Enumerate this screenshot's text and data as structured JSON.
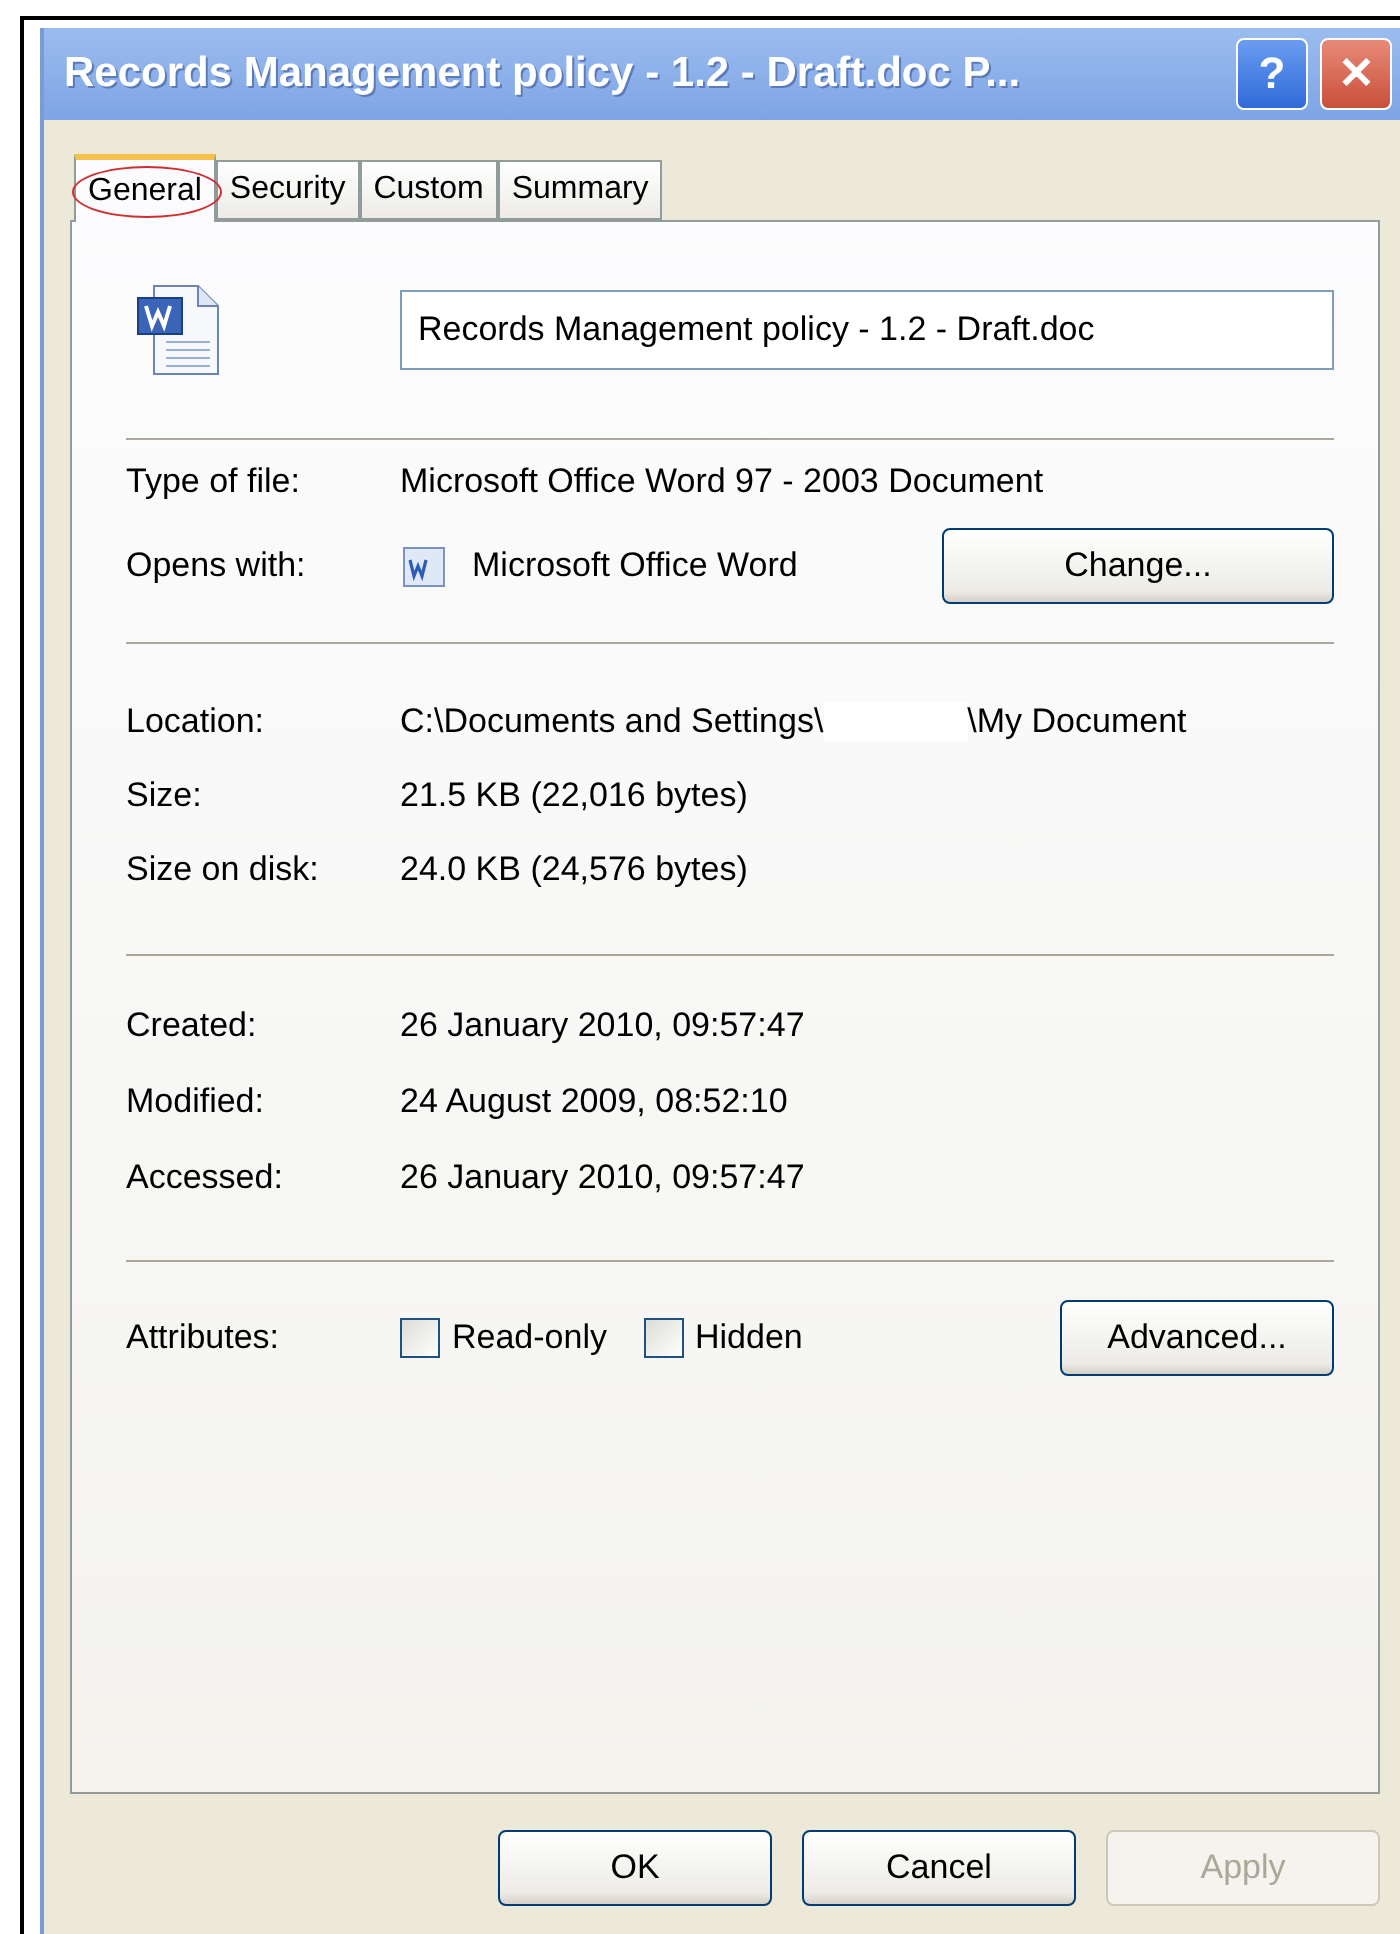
{
  "window": {
    "title": "Records Management policy - 1.2 - Draft.doc P...",
    "help_button": "?",
    "close_button": "✕"
  },
  "tabs": [
    {
      "label": "General",
      "selected": true,
      "circled": true
    },
    {
      "label": "Security",
      "selected": false,
      "circled": false
    },
    {
      "label": "Custom",
      "selected": false,
      "circled": false
    },
    {
      "label": "Summary",
      "selected": false,
      "circled": false
    }
  ],
  "file_name": "Records Management policy - 1.2 - Draft.doc",
  "type_of_file": {
    "label": "Type of file:",
    "value": "Microsoft Office Word 97 - 2003 Document"
  },
  "opens_with": {
    "label": "Opens with:",
    "value": "Microsoft Office Word",
    "button": "Change..."
  },
  "location": {
    "label": "Location:",
    "value_start": "C:\\Documents and Settings\\",
    "redacted": true,
    "value_end": "\\My Document"
  },
  "size": {
    "label": "Size:",
    "value": "21.5 KB (22,016 bytes)"
  },
  "size_on_disk": {
    "label": "Size on disk:",
    "value": "24.0 KB (24,576 bytes)"
  },
  "created": {
    "label": "Created:",
    "value": "26 January 2010, 09:57:47"
  },
  "modified": {
    "label": "Modified:",
    "value": "24 August 2009, 08:52:10"
  },
  "accessed": {
    "label": "Accessed:",
    "value": "26 January 2010, 09:57:47"
  },
  "attributes": {
    "label": "Attributes:",
    "options": [
      {
        "label": "Read-only",
        "checked": false
      },
      {
        "label": "Hidden",
        "checked": false
      }
    ],
    "button": "Advanced..."
  },
  "buttons": [
    {
      "label": "OK",
      "disabled": false
    },
    {
      "label": "Cancel",
      "disabled": false
    },
    {
      "label": "Apply",
      "disabled": true
    }
  ]
}
